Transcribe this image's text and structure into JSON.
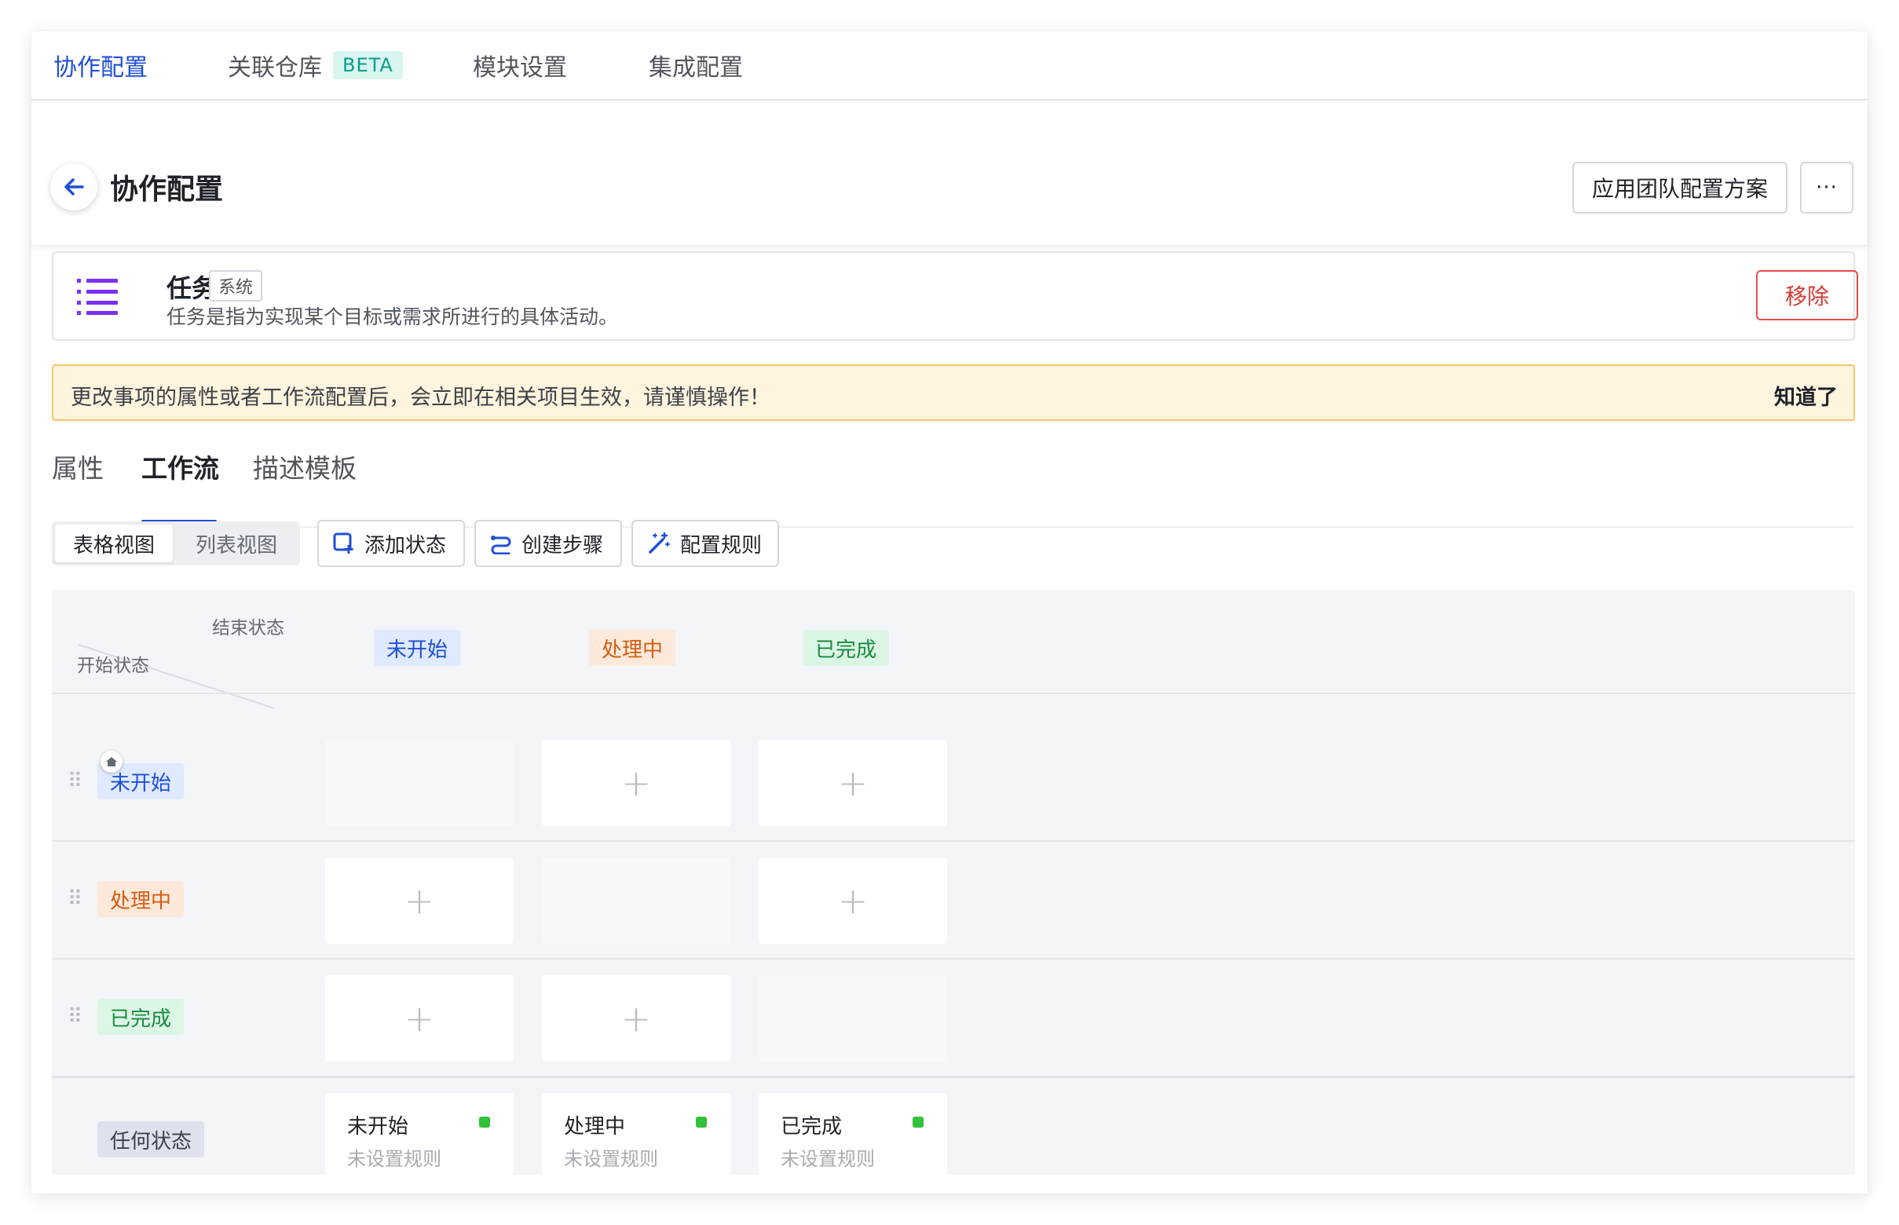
{
  "top_tabs": [
    {
      "label": "协作配置",
      "active": true
    },
    {
      "label": "关联仓库",
      "badge": "BETA"
    },
    {
      "label": "模块设置"
    },
    {
      "label": "集成配置"
    }
  ],
  "header": {
    "title": "协作配置",
    "apply_button": "应用团队配置方案",
    "more_button": "···"
  },
  "type_card": {
    "icon": "list-icon",
    "name": "任务",
    "system_tag": "系统",
    "description": "任务是指为实现某个目标或需求所进行的具体活动。",
    "remove_button": "移除"
  },
  "warning": {
    "text": "更改事项的属性或者工作流配置后，会立即在相关项目生效，请谨慎操作！",
    "dismiss": "知道了"
  },
  "sub_tabs": [
    {
      "label": "属性"
    },
    {
      "label": "工作流",
      "active": true
    },
    {
      "label": "描述模板"
    }
  ],
  "toolbar": {
    "view_table": "表格视图",
    "view_list": "列表视图",
    "add_state": "添加状态",
    "create_step": "创建步骤",
    "config_rules": "配置规则"
  },
  "matrix": {
    "corner_end": "结束状态",
    "corner_start": "开始状态",
    "columns": [
      "未开始",
      "处理中",
      "已完成"
    ],
    "rows": [
      "未开始",
      "处理中",
      "已完成"
    ],
    "any_state": "任何状态",
    "rule_cards": [
      {
        "name": "未开始",
        "sub": "未设置规则"
      },
      {
        "name": "处理中",
        "sub": "未设置规则"
      },
      {
        "name": "已完成",
        "sub": "未设置规则"
      }
    ]
  },
  "colors": {
    "accent": "#1f4fd6",
    "danger": "#d83931",
    "warning_bg": "#fff4de",
    "status_blue": "#1f4fd6",
    "status_orange": "#d45d13",
    "status_green": "#1a8a3f",
    "rule_dot": "#34c03a"
  }
}
